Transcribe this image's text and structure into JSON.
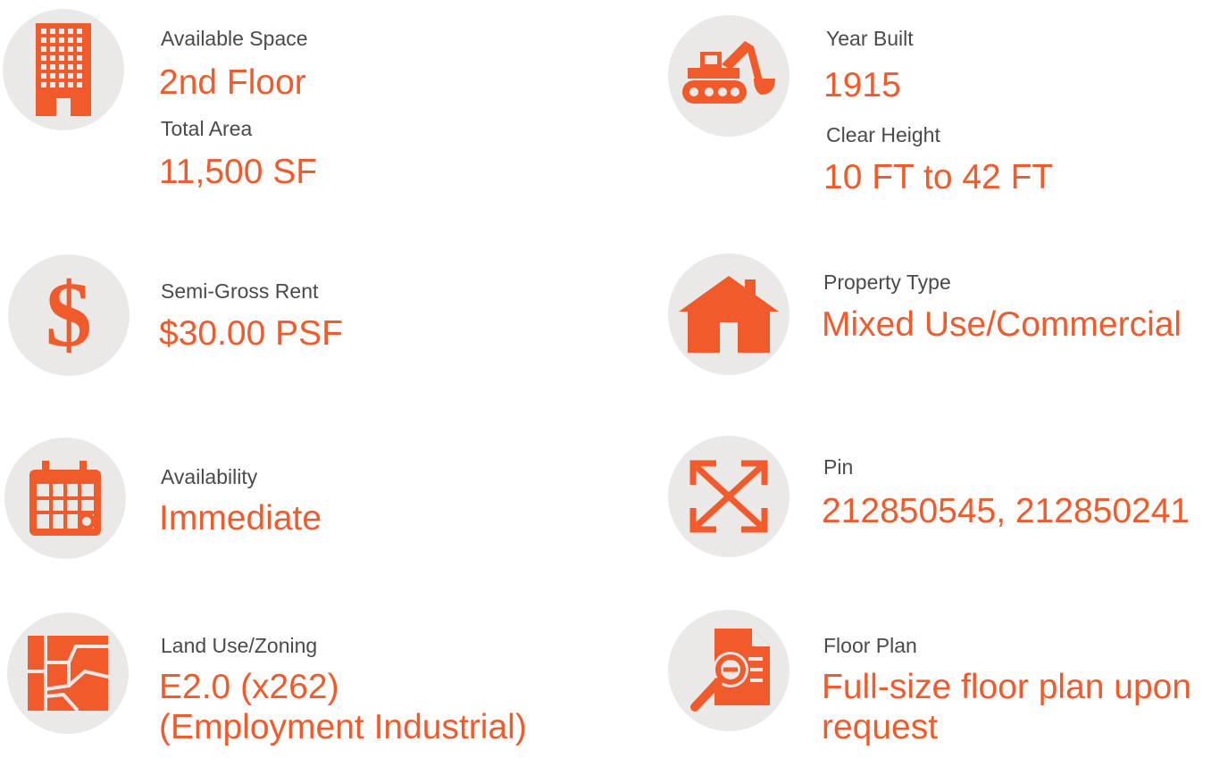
{
  "colors": {
    "accent": "#f15a2b",
    "circle_bg": "#ebe9e8",
    "label_text": "#4a4a4a"
  },
  "items": [
    {
      "icon": "building-icon",
      "fields": [
        {
          "label": "Available Space",
          "value": "2nd Floor"
        },
        {
          "label": "Total Area",
          "value": "11,500 SF"
        }
      ]
    },
    {
      "icon": "excavator-icon",
      "fields": [
        {
          "label": "Year Built",
          "value": "1915"
        },
        {
          "label": "Clear Height",
          "value": "10 FT to 42 FT"
        }
      ]
    },
    {
      "icon": "dollar-icon",
      "fields": [
        {
          "label": "Semi-Gross Rent",
          "value": "$30.00 PSF"
        }
      ]
    },
    {
      "icon": "house-icon",
      "fields": [
        {
          "label": "Property Type",
          "value": "Mixed Use/Commercial"
        }
      ]
    },
    {
      "icon": "calendar-icon",
      "fields": [
        {
          "label": "Availability",
          "value": "Immediate"
        }
      ]
    },
    {
      "icon": "expand-arrows-icon",
      "fields": [
        {
          "label": "Pin",
          "value": "212850545, 212850241"
        }
      ]
    },
    {
      "icon": "map-icon",
      "fields": [
        {
          "label": "Land Use/Zoning",
          "value": "E2.0 (x262)",
          "value_line2": "(Employment Industrial)"
        }
      ]
    },
    {
      "icon": "document-search-icon",
      "fields": [
        {
          "label": "Floor Plan",
          "value": "Full-size floor plan upon",
          "value_line2": "request"
        }
      ]
    }
  ]
}
